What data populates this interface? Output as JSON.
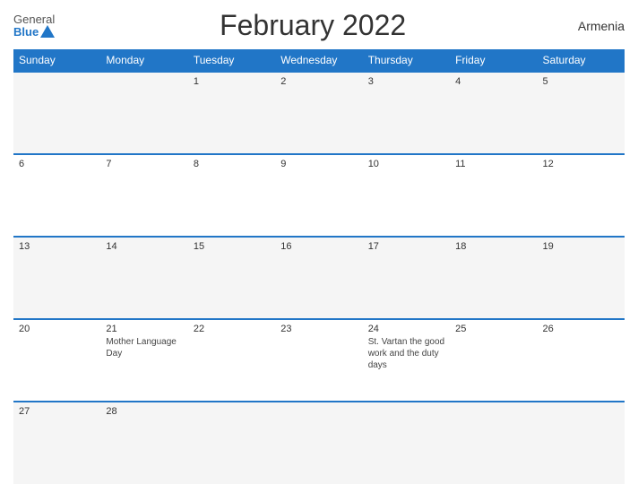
{
  "header": {
    "logo_general": "General",
    "logo_blue": "Blue",
    "title": "February 2022",
    "country": "Armenia"
  },
  "weekdays": [
    "Sunday",
    "Monday",
    "Tuesday",
    "Wednesday",
    "Thursday",
    "Friday",
    "Saturday"
  ],
  "weeks": [
    [
      {
        "day": "",
        "empty": true
      },
      {
        "day": "",
        "empty": true
      },
      {
        "day": "1",
        "empty": false,
        "event": ""
      },
      {
        "day": "2",
        "empty": false,
        "event": ""
      },
      {
        "day": "3",
        "empty": false,
        "event": ""
      },
      {
        "day": "4",
        "empty": false,
        "event": ""
      },
      {
        "day": "5",
        "empty": false,
        "event": ""
      }
    ],
    [
      {
        "day": "6",
        "empty": false,
        "event": ""
      },
      {
        "day": "7",
        "empty": false,
        "event": ""
      },
      {
        "day": "8",
        "empty": false,
        "event": ""
      },
      {
        "day": "9",
        "empty": false,
        "event": ""
      },
      {
        "day": "10",
        "empty": false,
        "event": ""
      },
      {
        "day": "11",
        "empty": false,
        "event": ""
      },
      {
        "day": "12",
        "empty": false,
        "event": ""
      }
    ],
    [
      {
        "day": "13",
        "empty": false,
        "event": ""
      },
      {
        "day": "14",
        "empty": false,
        "event": ""
      },
      {
        "day": "15",
        "empty": false,
        "event": ""
      },
      {
        "day": "16",
        "empty": false,
        "event": ""
      },
      {
        "day": "17",
        "empty": false,
        "event": ""
      },
      {
        "day": "18",
        "empty": false,
        "event": ""
      },
      {
        "day": "19",
        "empty": false,
        "event": ""
      }
    ],
    [
      {
        "day": "20",
        "empty": false,
        "event": ""
      },
      {
        "day": "21",
        "empty": false,
        "event": "Mother Language Day"
      },
      {
        "day": "22",
        "empty": false,
        "event": ""
      },
      {
        "day": "23",
        "empty": false,
        "event": ""
      },
      {
        "day": "24",
        "empty": false,
        "event": "St. Vartan the good work and the duty days"
      },
      {
        "day": "25",
        "empty": false,
        "event": ""
      },
      {
        "day": "26",
        "empty": false,
        "event": ""
      }
    ],
    [
      {
        "day": "27",
        "empty": false,
        "event": ""
      },
      {
        "day": "28",
        "empty": false,
        "event": ""
      },
      {
        "day": "",
        "empty": true
      },
      {
        "day": "",
        "empty": true
      },
      {
        "day": "",
        "empty": true
      },
      {
        "day": "",
        "empty": true
      },
      {
        "day": "",
        "empty": true
      }
    ]
  ]
}
